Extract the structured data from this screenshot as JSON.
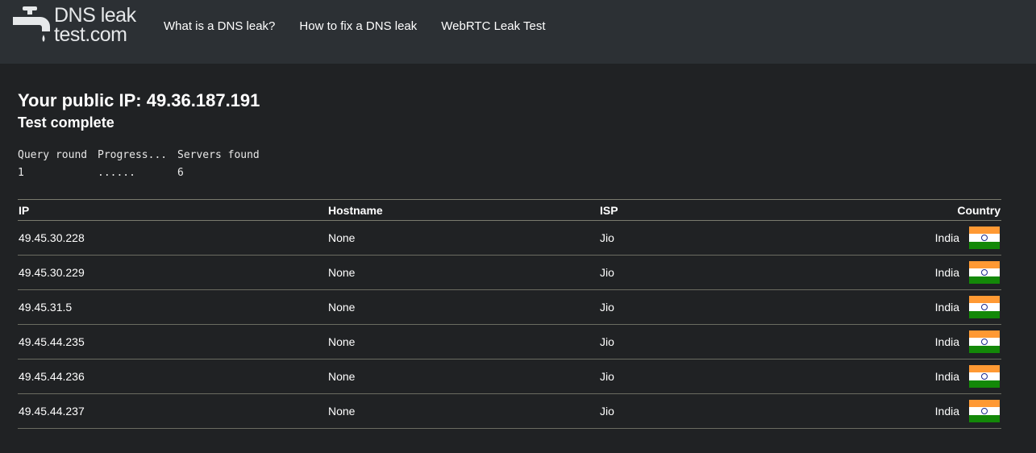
{
  "header": {
    "logo": {
      "line1": "DNS leak",
      "line2": "test.com"
    },
    "nav": [
      {
        "label": "What is a DNS leak?"
      },
      {
        "label": "How to fix a DNS leak"
      },
      {
        "label": "WebRTC Leak Test"
      }
    ]
  },
  "main": {
    "public_ip_label": "Your public IP: 49.36.187.191",
    "status": "Test complete",
    "progress": {
      "headers": [
        "Query round",
        "Progress...",
        "Servers found"
      ],
      "values": [
        "1",
        "......",
        "6"
      ]
    },
    "table": {
      "headers": {
        "ip": "IP",
        "hostname": "Hostname",
        "isp": "ISP",
        "country": "Country"
      },
      "rows": [
        {
          "ip": "49.45.30.228",
          "hostname": "None",
          "isp": "Jio",
          "country": "India",
          "flag_icon": "india-flag-icon"
        },
        {
          "ip": "49.45.30.229",
          "hostname": "None",
          "isp": "Jio",
          "country": "India",
          "flag_icon": "india-flag-icon"
        },
        {
          "ip": "49.45.31.5",
          "hostname": "None",
          "isp": "Jio",
          "country": "India",
          "flag_icon": "india-flag-icon"
        },
        {
          "ip": "49.45.44.235",
          "hostname": "None",
          "isp": "Jio",
          "country": "India",
          "flag_icon": "india-flag-icon"
        },
        {
          "ip": "49.45.44.236",
          "hostname": "None",
          "isp": "Jio",
          "country": "India",
          "flag_icon": "india-flag-icon"
        },
        {
          "ip": "49.45.44.237",
          "hostname": "None",
          "isp": "Jio",
          "country": "India",
          "flag_icon": "india-flag-icon"
        }
      ]
    }
  },
  "colors": {
    "page_background": "#202224",
    "header_background": "#2c3034",
    "text": "#ffffff",
    "divider": "#7a7b6e"
  }
}
